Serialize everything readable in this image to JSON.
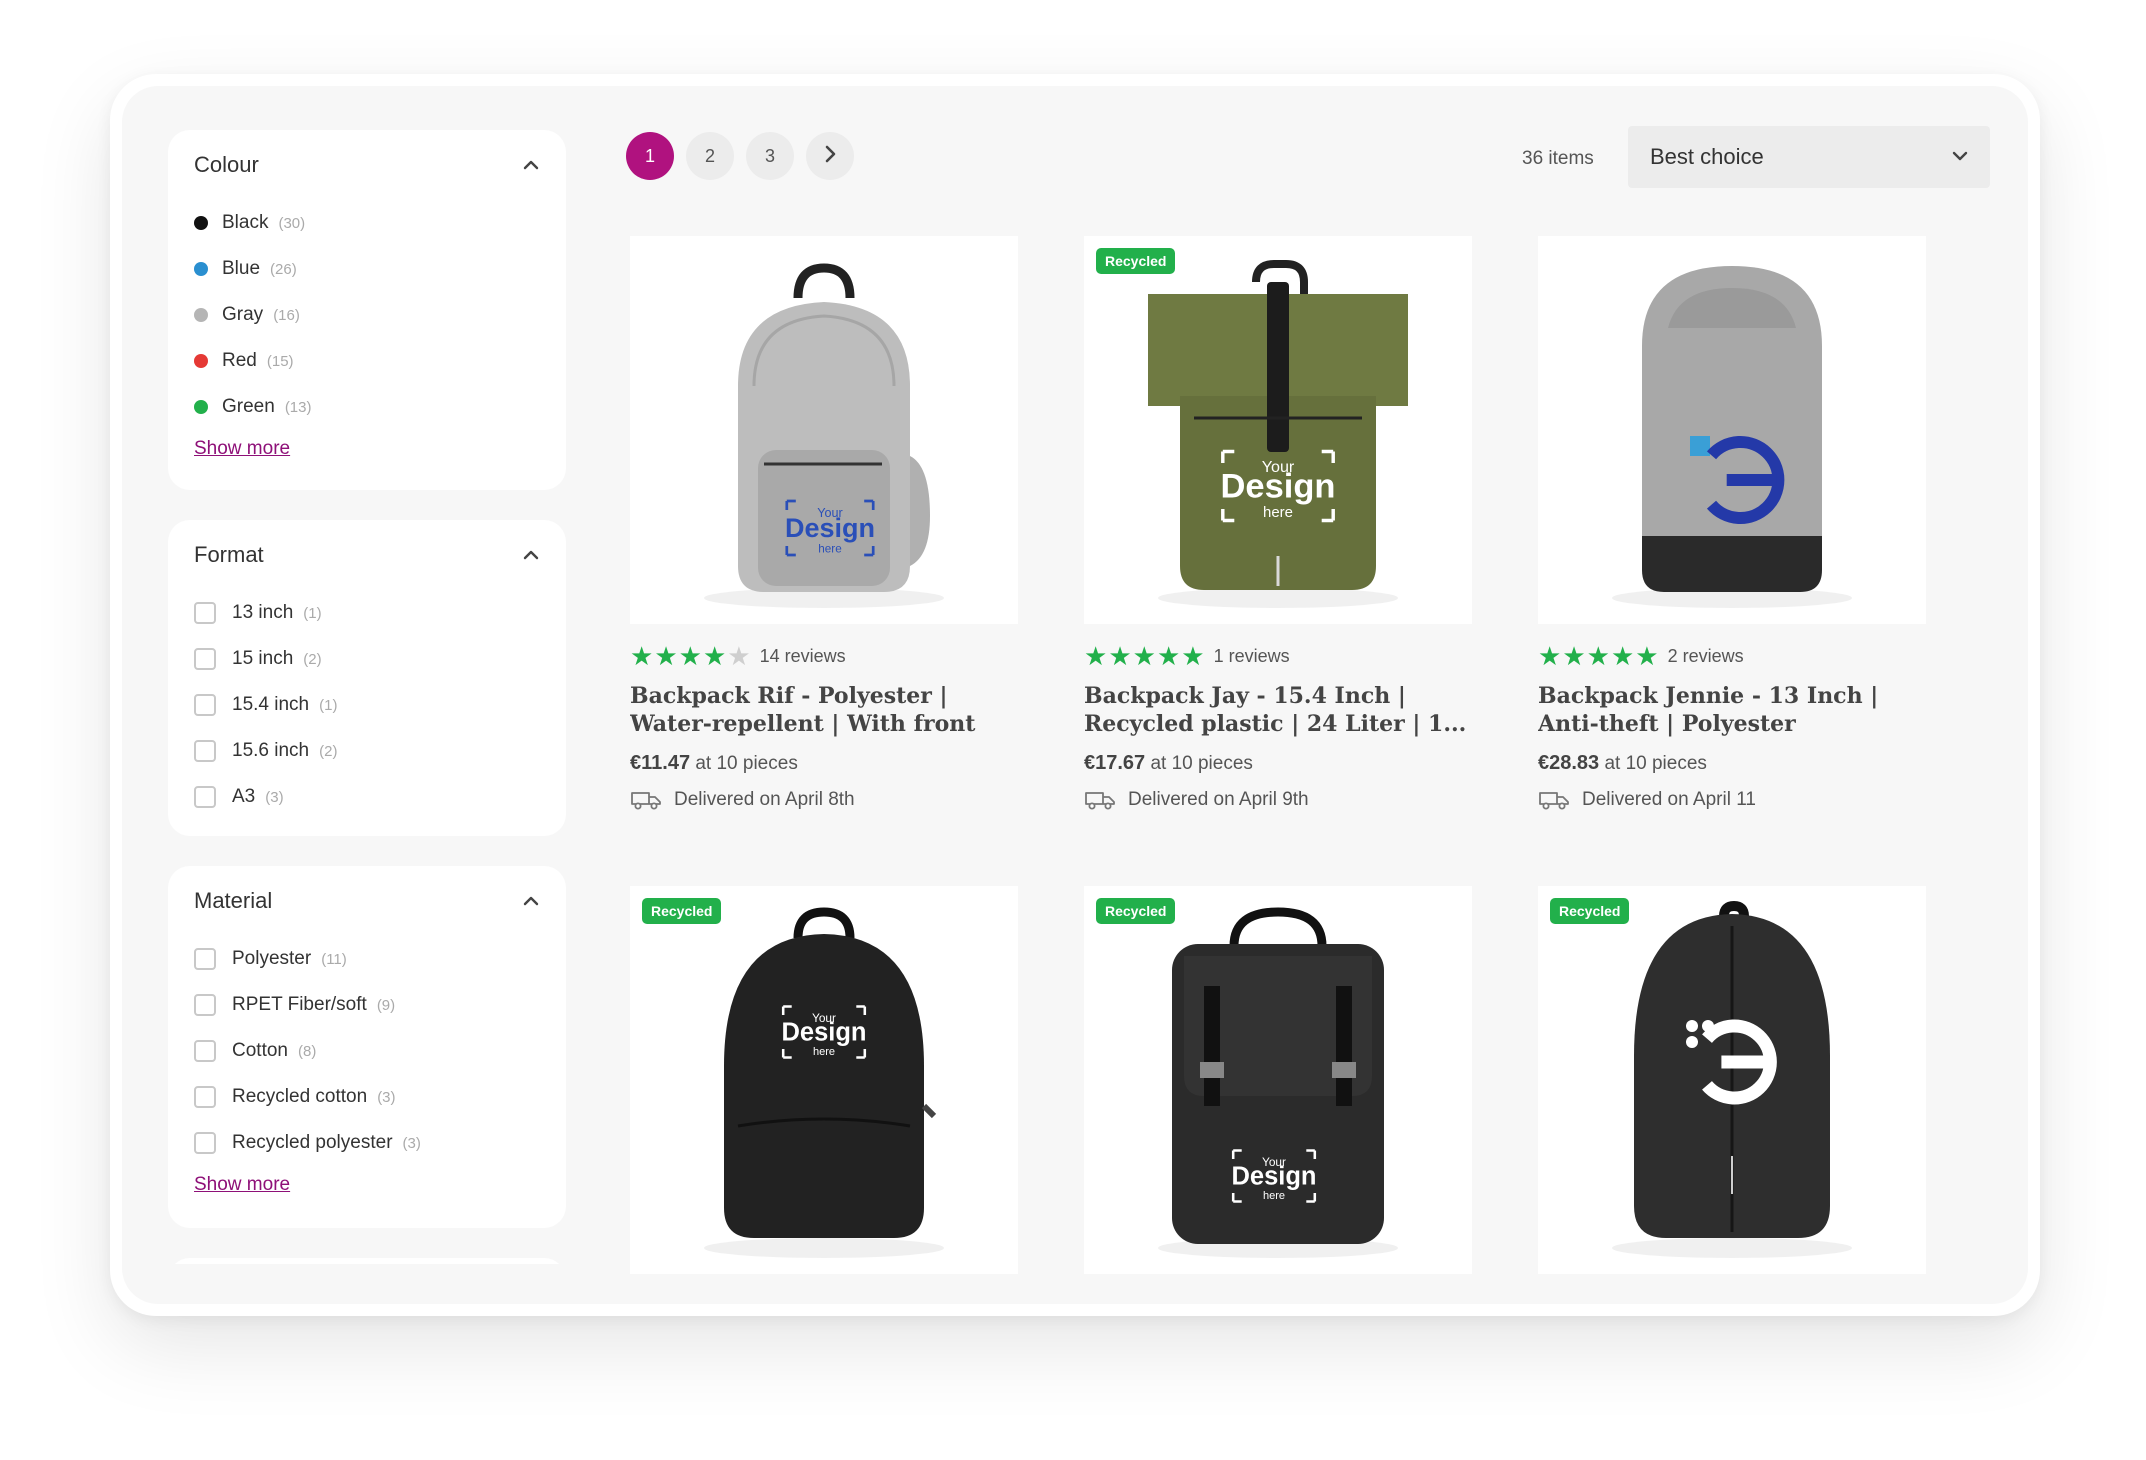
{
  "filters": {
    "colour": {
      "title": "Colour",
      "items": [
        {
          "label": "Black",
          "count": "(30)",
          "color": "#111111"
        },
        {
          "label": "Blue",
          "count": "(26)",
          "color": "#2a8fd0"
        },
        {
          "label": "Gray",
          "count": "(16)",
          "color": "#b5b5b5"
        },
        {
          "label": "Red",
          "count": "(15)",
          "color": "#e53935"
        },
        {
          "label": "Green",
          "count": "(13)",
          "color": "#22b04b"
        }
      ],
      "show_more": "Show more"
    },
    "format": {
      "title": "Format",
      "items": [
        {
          "label": "13 inch",
          "count": "(1)"
        },
        {
          "label": "15 inch",
          "count": "(2)"
        },
        {
          "label": "15.4 inch",
          "count": "(1)"
        },
        {
          "label": "15.6 inch",
          "count": "(2)"
        },
        {
          "label": "A3",
          "count": "(3)"
        }
      ]
    },
    "material": {
      "title": "Material",
      "items": [
        {
          "label": "Polyester",
          "count": "(11)"
        },
        {
          "label": "RPET Fiber/soft",
          "count": "(9)"
        },
        {
          "label": "Cotton",
          "count": "(8)"
        },
        {
          "label": "Recycled cotton",
          "count": "(3)"
        },
        {
          "label": "Recycled polyester",
          "count": "(3)"
        }
      ],
      "show_more": "Show more"
    }
  },
  "pagination": {
    "pages": [
      "1",
      "2",
      "3"
    ],
    "active": "1",
    "next_icon": "chevron-right-icon"
  },
  "toolbar": {
    "items_count": "36 items",
    "sort_value": "Best choice"
  },
  "products": [
    {
      "badge": "",
      "rating": 4,
      "reviews": "14 reviews",
      "title": "Backpack Rif - Polyester | Water-repellent | With front pocket | ...",
      "price": "€11.47",
      "price_note": "at 10 pieces",
      "delivery": "Delivered on April 8th",
      "image": "gray-backpack-your-design"
    },
    {
      "badge": "Recycled",
      "rating": 5,
      "reviews": "1 reviews",
      "title": "Backpack Jay - 15.4 Inch | Recycled plastic | 24 Liter | 1...",
      "price": "€17.67",
      "price_note": "at 10 pieces",
      "delivery": "Delivered on April 9th",
      "image": "olive-rolltop-backpack-your-design"
    },
    {
      "badge": "",
      "rating": 5,
      "reviews": "2 reviews",
      "title": "Backpack Jennie - 13 Inch | Anti-theft | Polyester",
      "price": "€28.83",
      "price_note": "at 10 pieces",
      "delivery": "Delivered on April 11",
      "image": "gray-antitheft-backpack-logo"
    },
    {
      "badge": "Recycled",
      "rating": 0,
      "reviews": "",
      "title": "",
      "price": "",
      "price_note": "",
      "delivery": "",
      "image": "black-backpack-your-design"
    },
    {
      "badge": "Recycled",
      "rating": 0,
      "reviews": "",
      "title": "",
      "price": "",
      "price_note": "",
      "delivery": "",
      "image": "black-flap-backpack-your-design"
    },
    {
      "badge": "Recycled",
      "rating": 0,
      "reviews": "",
      "title": "",
      "price": "",
      "price_note": "",
      "delivery": "",
      "image": "black-antitheft-backpack-logo"
    }
  ],
  "design_placeholder": {
    "line1": "Your",
    "line2": "Design",
    "line3": "here"
  },
  "colors": {
    "accent": "#b0127f",
    "link": "#8e1078",
    "recycled": "#22b04b",
    "star": "#22b04b",
    "star_empty": "#cfcfcf"
  }
}
